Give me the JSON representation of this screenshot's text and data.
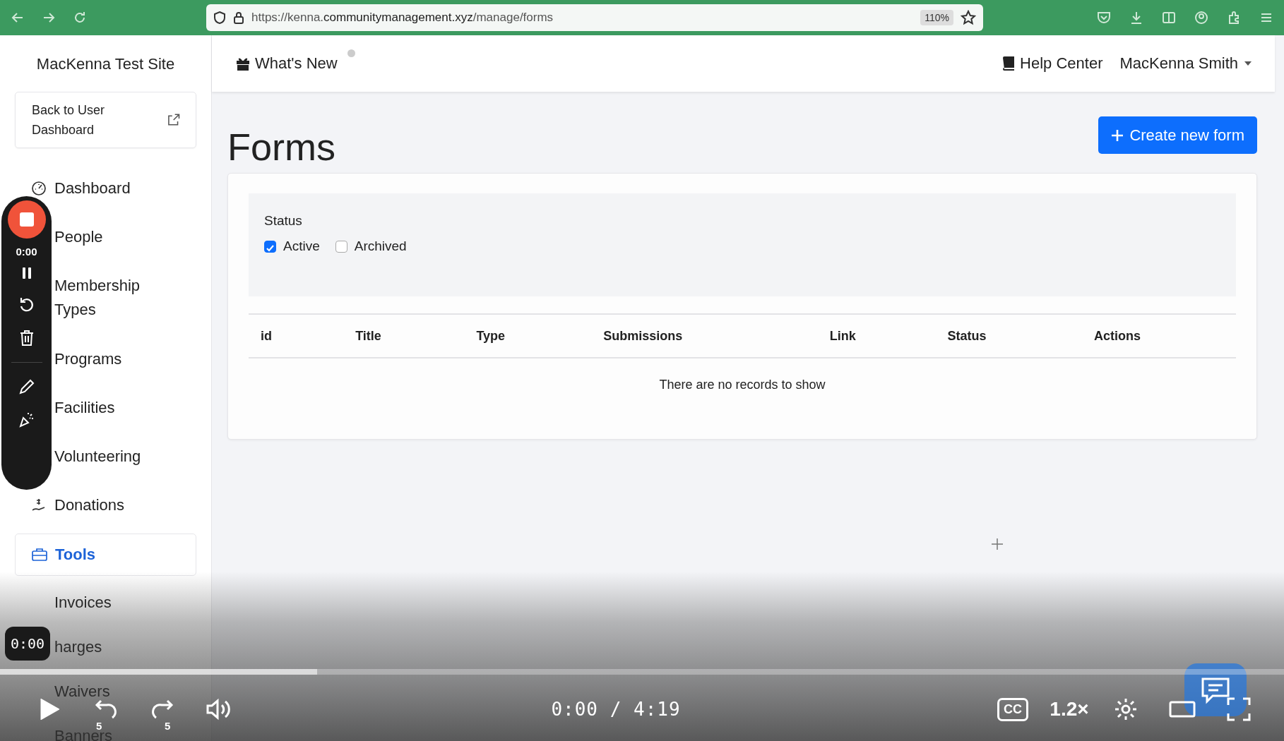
{
  "browser": {
    "url_prefix": "https://kenna.",
    "url_domain": "communitymanagement.xyz",
    "url_path": "/manage/forms",
    "zoom": "110%"
  },
  "sidebar": {
    "site_title": "MacKenna Test Site",
    "back_link": "Back to User Dashboard",
    "items": [
      {
        "label": "Dashboard",
        "kind": "gauge",
        "selected": false
      },
      {
        "label": "People",
        "kind": "hidden",
        "selected": false
      },
      {
        "label": "Membership Types",
        "kind": "hidden",
        "selected": false
      },
      {
        "label": "Programs",
        "kind": "hidden",
        "selected": false
      },
      {
        "label": "Facilities",
        "kind": "hidden",
        "selected": false
      },
      {
        "label": "Volunteering",
        "kind": "hidden",
        "selected": false
      },
      {
        "label": "Donations",
        "kind": "donation",
        "selected": false
      },
      {
        "label": "Tools",
        "kind": "toolbox",
        "selected": true,
        "children": [
          {
            "label": "Invoices"
          },
          {
            "label": "harges"
          },
          {
            "label": "Waivers"
          },
          {
            "label": "Banners"
          }
        ]
      }
    ]
  },
  "topbar": {
    "whats_new": "What's New",
    "help_center": "Help Center",
    "user": "MacKenna Smith"
  },
  "page": {
    "title": "Forms",
    "create_button": "Create new form",
    "filter": {
      "label": "Status",
      "options": [
        {
          "label": "Active",
          "checked": true
        },
        {
          "label": "Archived",
          "checked": false
        }
      ]
    },
    "table": {
      "columns": [
        "id",
        "Title",
        "Type",
        "Submissions",
        "Link",
        "Status",
        "Actions"
      ],
      "empty_message": "There are no records to show"
    }
  },
  "recorder": {
    "time": "0:00"
  },
  "video": {
    "hover_time": "0:00",
    "time": "0:00 / 4:19",
    "progress": {
      "level": 0.247
    },
    "skip_back": "5",
    "skip_forward": "5",
    "captions": "CC",
    "speed": "1.2×"
  }
}
